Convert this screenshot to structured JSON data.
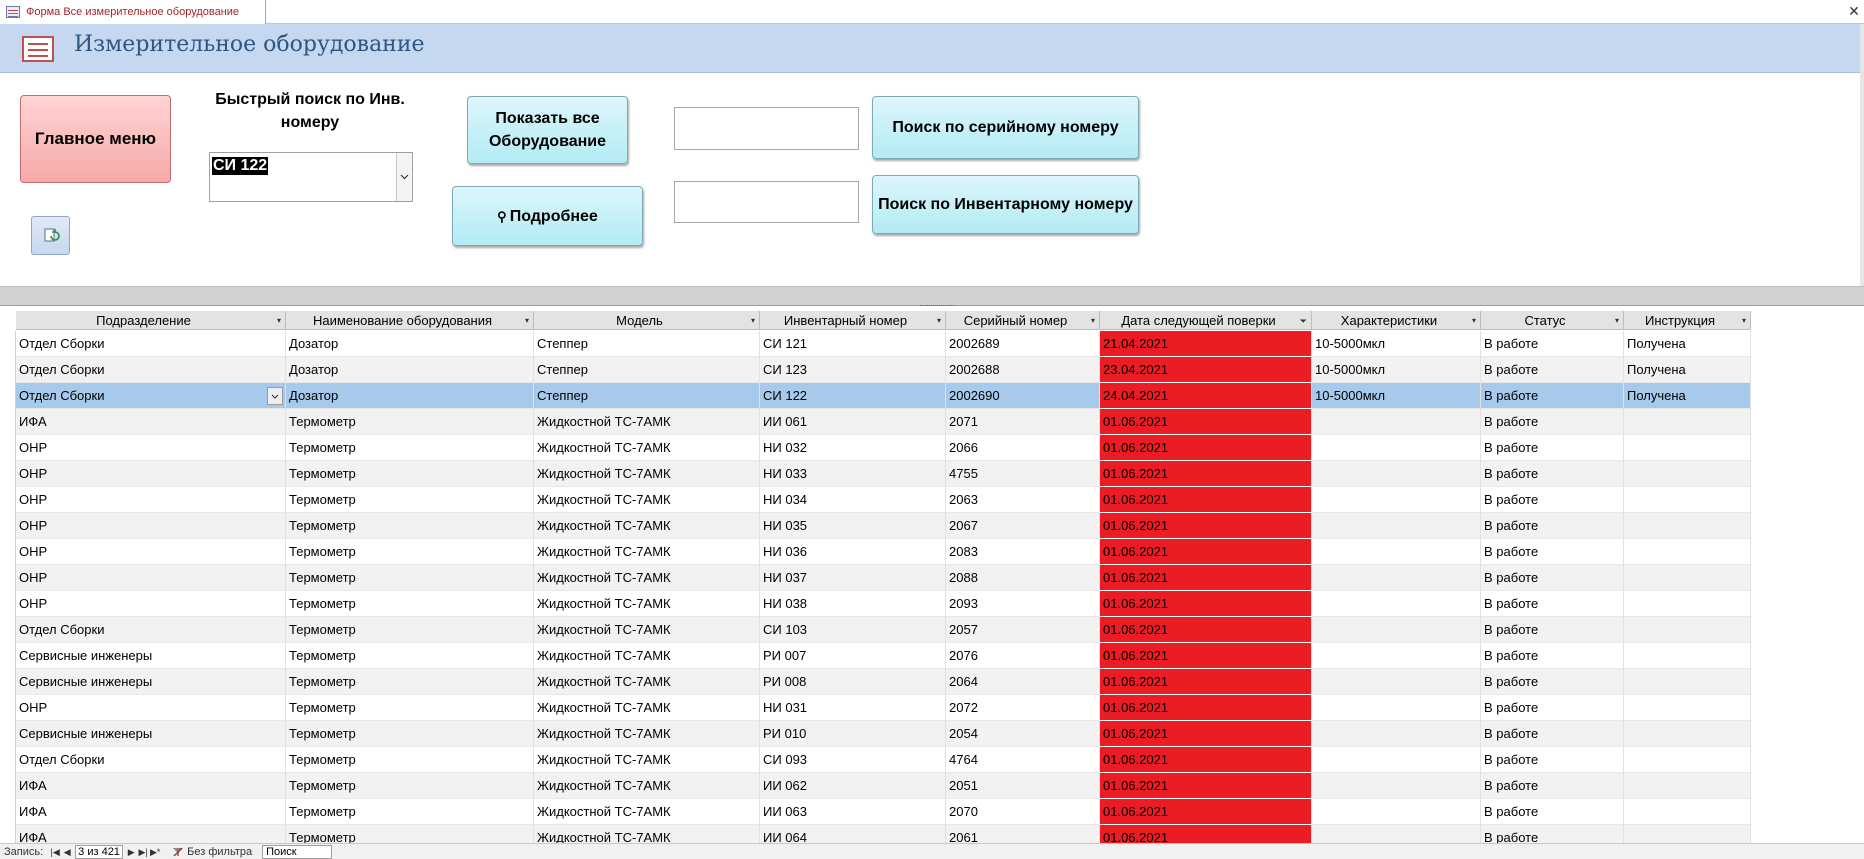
{
  "tab": {
    "title": "Форма Все измерительное оборудование"
  },
  "header": {
    "title": "Измерительное оборудование"
  },
  "form": {
    "main_menu_label": "Главное меню",
    "quick_search_label": "Быстрый поиск по Инв. номеру",
    "quick_search_value": "СИ 122",
    "show_all_label": "Показать все Оборудование",
    "details_label": "Подробнее",
    "serial_search_label": "Поиск по серийному номеру",
    "inventory_search_label": "Поиск по Инвентарному номеру",
    "serial_input_value": "",
    "inventory_input_value": ""
  },
  "columns": [
    "Подразделение",
    "Наименование оборудования",
    "Модель",
    "Инвентарный номер",
    "Серийный номер",
    "Дата следующей поверки",
    "Характеристики",
    "Статус",
    "Инструкция"
  ],
  "rows": [
    [
      "Отдел Сборки",
      "Дозатор",
      "Степпер",
      "СИ 121",
      "2002689",
      "21.04.2021",
      "10-5000мкл",
      "В работе",
      "Получена"
    ],
    [
      "Отдел Сборки",
      "Дозатор",
      "Степпер",
      "СИ 123",
      "2002688",
      "23.04.2021",
      "10-5000мкл",
      "В работе",
      "Получена"
    ],
    [
      "Отдел Сборки",
      "Дозатор",
      "Степпер",
      "СИ 122",
      "2002690",
      "24.04.2021",
      "10-5000мкл",
      "В работе",
      "Получена"
    ],
    [
      "ИФА",
      "Термометр",
      "Жидкостной ТС-7АМК",
      "ИИ 061",
      "2071",
      "01.06.2021",
      "",
      "В работе",
      ""
    ],
    [
      "ОНР",
      "Термометр",
      "Жидкостной ТС-7АМК",
      "НИ 032",
      "2066",
      "01.06.2021",
      "",
      "В работе",
      ""
    ],
    [
      "ОНР",
      "Термометр",
      "Жидкостной ТС-7АМК",
      "НИ 033",
      "4755",
      "01.06.2021",
      "",
      "В работе",
      ""
    ],
    [
      "ОНР",
      "Термометр",
      "Жидкостной ТС-7АМК",
      "НИ 034",
      "2063",
      "01.06.2021",
      "",
      "В работе",
      ""
    ],
    [
      "ОНР",
      "Термометр",
      "Жидкостной ТС-7АМК",
      "НИ 035",
      "2067",
      "01.06.2021",
      "",
      "В работе",
      ""
    ],
    [
      "ОНР",
      "Термометр",
      "Жидкостной ТС-7АМК",
      "НИ 036",
      "2083",
      "01.06.2021",
      "",
      "В работе",
      ""
    ],
    [
      "ОНР",
      "Термометр",
      "Жидкостной ТС-7АМК",
      "НИ 037",
      "2088",
      "01.06.2021",
      "",
      "В работе",
      ""
    ],
    [
      "ОНР",
      "Термометр",
      "Жидкостной ТС-7АМК",
      "НИ 038",
      "2093",
      "01.06.2021",
      "",
      "В работе",
      ""
    ],
    [
      "Отдел Сборки",
      "Термометр",
      "Жидкостной ТС-7АМК",
      "СИ 103",
      "2057",
      "01.06.2021",
      "",
      "В работе",
      ""
    ],
    [
      "Сервисные инженеры",
      "Термометр",
      "Жидкостной ТС-7АМК",
      "РИ 007",
      "2076",
      "01.06.2021",
      "",
      "В работе",
      ""
    ],
    [
      "Сервисные инженеры",
      "Термометр",
      "Жидкостной ТС-7АМК",
      "РИ 008",
      "2064",
      "01.06.2021",
      "",
      "В работе",
      ""
    ],
    [
      "ОНР",
      "Термометр",
      "Жидкостной ТС-7АМК",
      "НИ 031",
      "2072",
      "01.06.2021",
      "",
      "В работе",
      ""
    ],
    [
      "Сервисные инженеры",
      "Термометр",
      "Жидкостной ТС-7АМК",
      "РИ 010",
      "2054",
      "01.06.2021",
      "",
      "В работе",
      ""
    ],
    [
      "Отдел Сборки",
      "Термометр",
      "Жидкостной ТС-7АМК",
      "СИ 093",
      "4764",
      "01.06.2021",
      "",
      "В работе",
      ""
    ],
    [
      "ИФА",
      "Термометр",
      "Жидкостной ТС-7АМК",
      "ИИ 062",
      "2051",
      "01.06.2021",
      "",
      "В работе",
      ""
    ],
    [
      "ИФА",
      "Термометр",
      "Жидкостной ТС-7АМК",
      "ИИ 063",
      "2070",
      "01.06.2021",
      "",
      "В работе",
      ""
    ],
    [
      "ИФА",
      "Термометр",
      "Жидкостной ТС-7АМК",
      "ИИ 064",
      "2061",
      "01.06.2021",
      "",
      "В работе",
      ""
    ]
  ],
  "selected_row": 2,
  "nav": {
    "record_label": "Запись:",
    "record_position": "3 из 421",
    "filter_label": "Без фильтра",
    "search_label": "Поиск"
  },
  "colors": {
    "overdue": "#ec1c24",
    "selected_row": "#a7c9ec",
    "header_band": "#c5d8ef"
  }
}
